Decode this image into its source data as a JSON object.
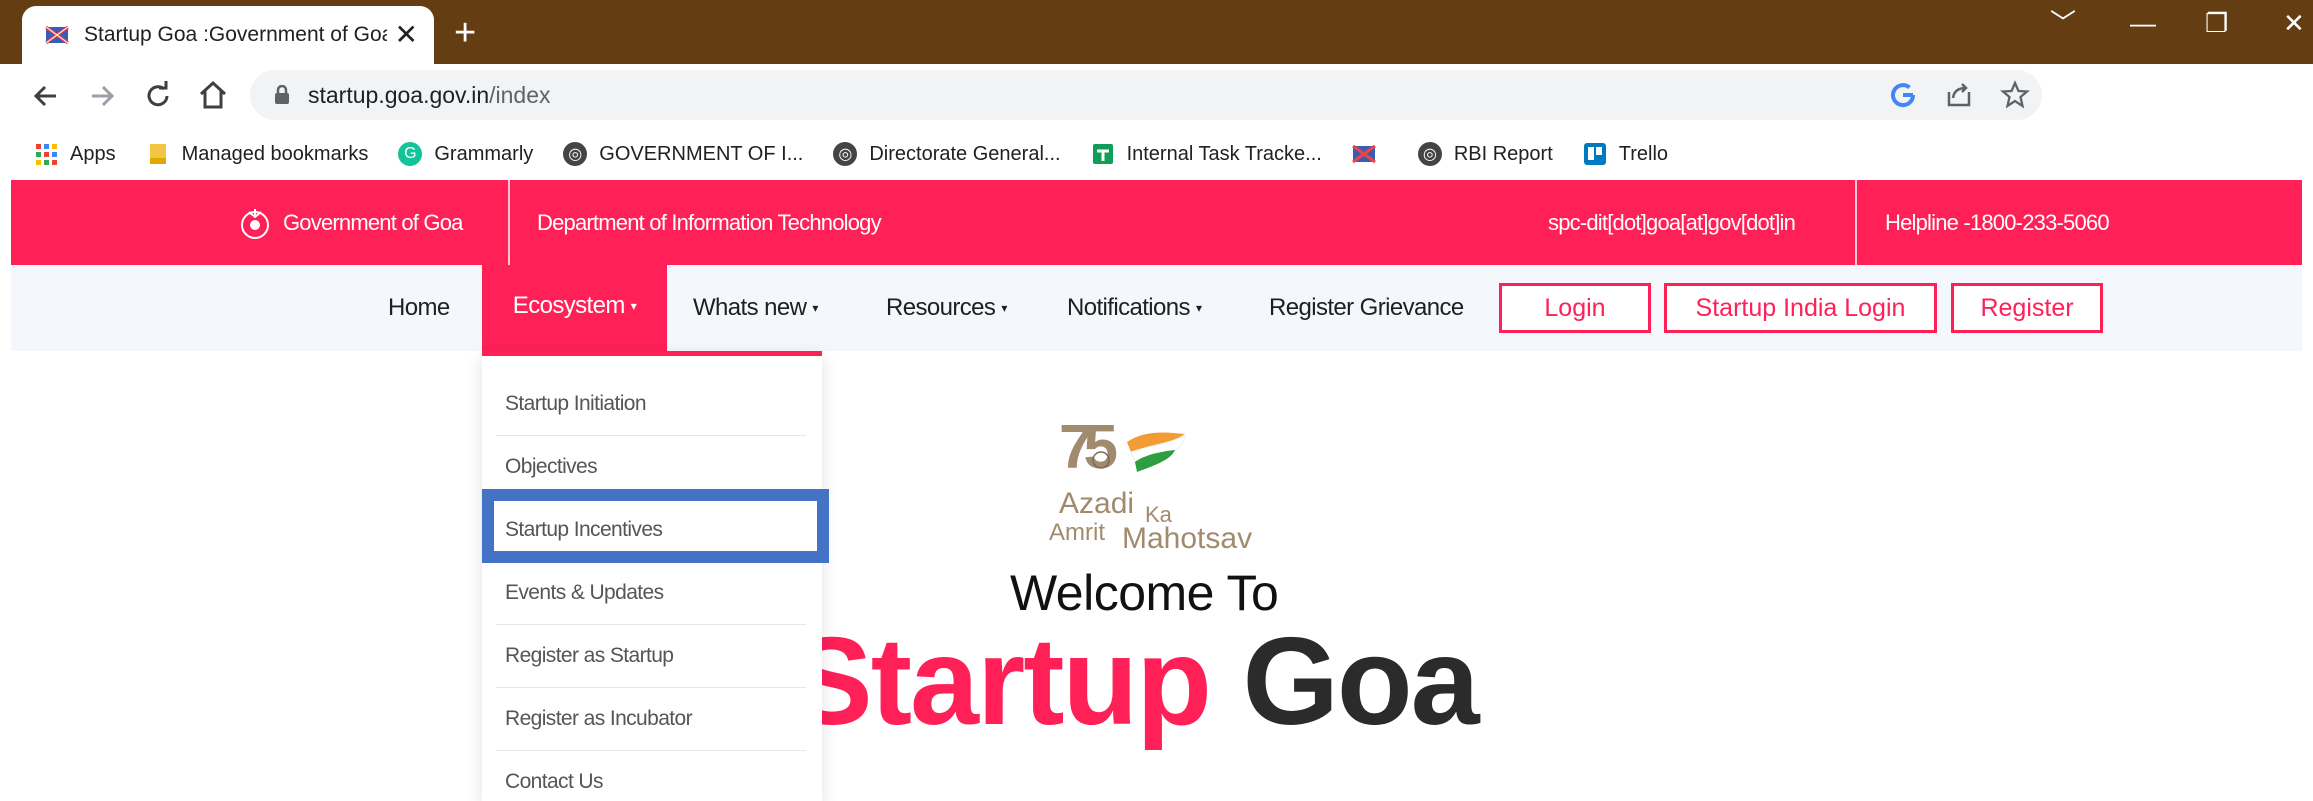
{
  "browser": {
    "tab_title": "Startup Goa :Government of Goa",
    "tab_close": "✕",
    "new_tab": "+",
    "url_host": "startup.goa.gov.in",
    "url_path": "/index",
    "window_controls": [
      "﹀",
      "—",
      "❐",
      "✕"
    ]
  },
  "bookmarks": [
    {
      "label": "Apps",
      "icon": "apps-grid-icon"
    },
    {
      "label": "Managed bookmarks",
      "icon": "folder-icon"
    },
    {
      "label": "Grammarly",
      "icon": "grammarly-icon"
    },
    {
      "label": "GOVERNMENT OF I...",
      "icon": "globe-icon"
    },
    {
      "label": "Directorate General...",
      "icon": "globe-icon"
    },
    {
      "label": "Internal Task Tracke...",
      "icon": "sheets-icon"
    },
    {
      "label": "",
      "icon": "flag-icon"
    },
    {
      "label": "RBI Report",
      "icon": "globe-icon"
    },
    {
      "label": "Trello",
      "icon": "trello-icon"
    }
  ],
  "site_header": {
    "gov_label": "Government of Goa",
    "dept_label": "Department of Information Technology",
    "email": "spc-dit[dot]goa[at]gov[dot]in",
    "helpline": "Helpline -1800-233-5060"
  },
  "nav": {
    "home": "Home",
    "ecosystem": "Ecosystem",
    "whats_new": "Whats new",
    "resources": "Resources",
    "notifications": "Notifications",
    "grievance": "Register Grievance",
    "login": "Login",
    "startup_india_login": "Startup India Login",
    "register": "Register",
    "caret": "▾"
  },
  "dropdown": {
    "items": [
      "Startup Initiation",
      "Objectives",
      "Startup Incentives",
      "Events & Updates",
      "Register as Startup",
      "Register as Incubator",
      "Contact Us"
    ]
  },
  "hero": {
    "logo_75": "75",
    "logo_azadi": "Azadi",
    "logo_ka": "Ka",
    "logo_amrit": "Amrit",
    "logo_mahotsav": "Mahotsav",
    "welcome": "Welcome To",
    "title_part1": "Startup",
    "title_part2": "Goa"
  },
  "colors": {
    "brand_pink": "#fe2057",
    "chrome_brown": "#653d12",
    "highlight_blue": "#4472c4"
  }
}
